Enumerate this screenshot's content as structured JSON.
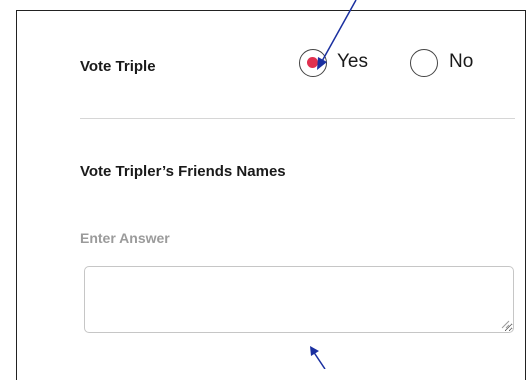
{
  "question_vote_triple": {
    "label": "Vote Triple",
    "options": [
      {
        "label": "Yes",
        "checked": true
      },
      {
        "label": "No",
        "checked": false
      }
    ],
    "selected_color": "#e0304f"
  },
  "question_friends": {
    "label": "Vote Tripler’s Friends Names",
    "field_label": "Enter Answer",
    "value": ""
  },
  "annotation_color": "#1a2fa0"
}
